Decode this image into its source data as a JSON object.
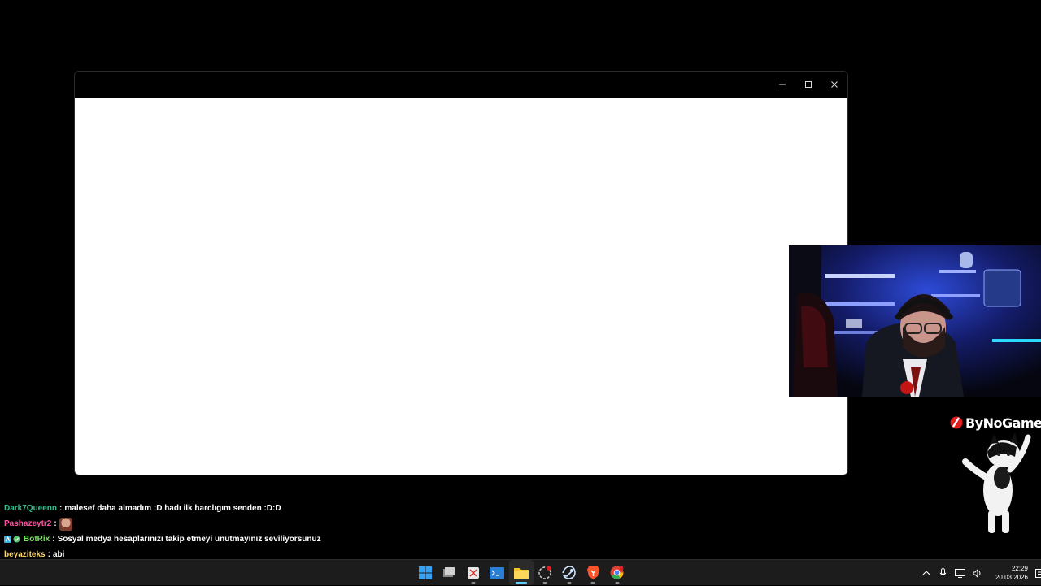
{
  "window": {
    "controls": [
      {
        "icon": "minimize-icon"
      },
      {
        "icon": "maximize-icon"
      },
      {
        "icon": "close-icon"
      }
    ]
  },
  "overlay": {
    "brand_text": "ByNoGame"
  },
  "chat": {
    "messages": [
      {
        "user": "Dark7Queenn",
        "user_color": "#2fc191",
        "text": "malesef daha almadım :D hadı ilk harclıgım senden :D:D"
      },
      {
        "user": "Pashazeytr2",
        "user_color": "#ff4fa0",
        "text": "",
        "emote": "face-emote"
      },
      {
        "user": "BotRix",
        "user_color": "#76e55a",
        "text": "Sosyal medya hesaplarınızı takip etmeyi unutmayınız seviliyorsunuz",
        "badges": [
          "bot-badge",
          "verified-badge"
        ]
      },
      {
        "user": "beyaziteks",
        "user_color": "#ffd86b",
        "text": "abi"
      }
    ]
  },
  "taskbar": {
    "apps": [
      {
        "icon": "windows-start-icon"
      },
      {
        "icon": "task-view-icon"
      },
      {
        "icon": "snipping-tool-icon"
      },
      {
        "icon": "terminal-icon"
      },
      {
        "icon": "file-explorer-icon",
        "active": true
      },
      {
        "icon": "recorder-icon"
      },
      {
        "icon": "steam-icon"
      },
      {
        "icon": "brave-icon"
      },
      {
        "icon": "chrome-icon"
      }
    ],
    "tray": {
      "icons": [
        "chevron-up-icon",
        "microphone-icon",
        "network-icon",
        "volume-icon"
      ],
      "time": "22:29",
      "date": "20.03.2026"
    }
  },
  "colors": {
    "background": "#000000",
    "window_content": "#ffffff",
    "taskbar": "#1c1c1c",
    "accent": "#60cdff"
  }
}
